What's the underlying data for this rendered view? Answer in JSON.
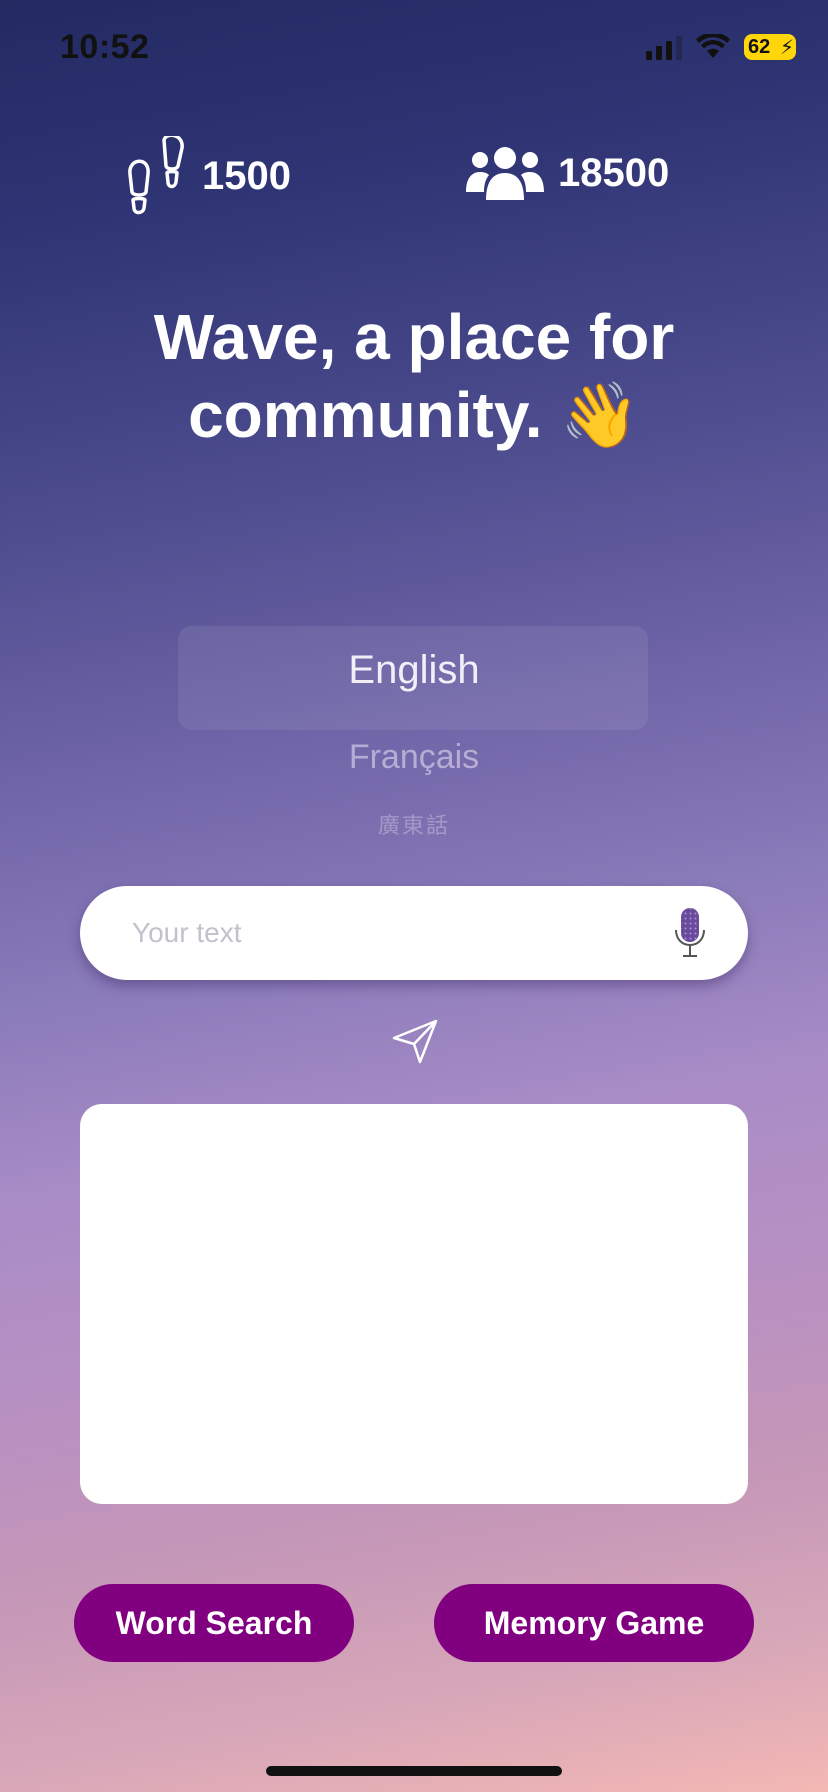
{
  "status_bar": {
    "time": "10:52",
    "battery": "62",
    "icons": [
      "signal-icon",
      "wifi-icon",
      "battery-charging-icon"
    ]
  },
  "stats": {
    "steps": {
      "icon": "footprints-icon",
      "value": "1500"
    },
    "community": {
      "icon": "group-icon",
      "value": "18500"
    }
  },
  "headline": "Wave, a place for community. 👋",
  "language_picker": {
    "options": [
      "English",
      "Français",
      "廣東話"
    ],
    "selected": "English"
  },
  "input": {
    "placeholder": "Your text",
    "value": "",
    "mic_icon": "microphone-icon"
  },
  "send_icon": "paper-plane-icon",
  "output": {
    "text": ""
  },
  "buttons": {
    "word_search": "Word Search",
    "memory_game": "Memory Game"
  },
  "colors": {
    "button": "#800080",
    "mic": "#6a4a9c"
  }
}
